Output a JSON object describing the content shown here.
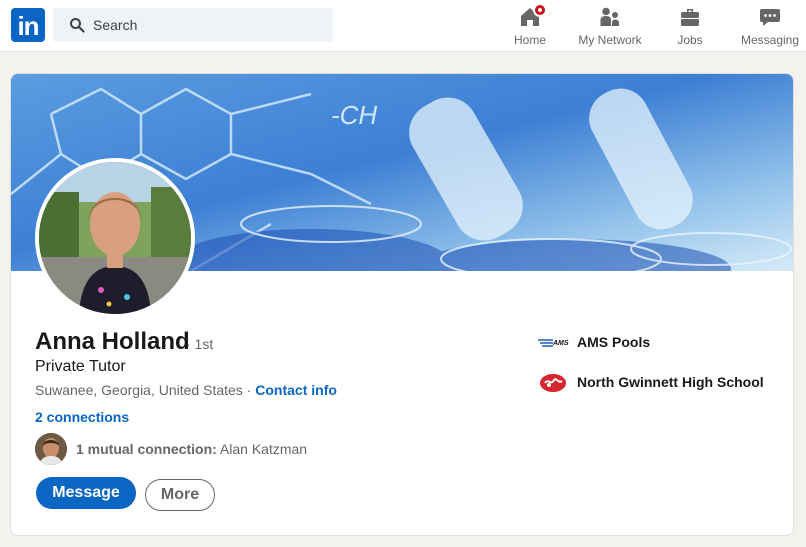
{
  "nav": {
    "logo_text": "in",
    "search_placeholder": "Search",
    "items": [
      {
        "label": "Home",
        "icon": "home-icon"
      },
      {
        "label": "My Network",
        "icon": "network-icon"
      },
      {
        "label": "Jobs",
        "icon": "briefcase-icon"
      },
      {
        "label": "Messaging",
        "icon": "chat-icon"
      }
    ]
  },
  "profile": {
    "name": "Anna Holland",
    "degree": "· 1st",
    "headline": "Private Tutor",
    "location": "Suwanee, Georgia, United States",
    "location_separator": " · ",
    "contact_label": "Contact info",
    "connections": "2 connections",
    "mutual_label": "1 mutual connection:",
    "mutual_name": "Alan Katzman",
    "message_button": "Message",
    "more_button": "More"
  },
  "experience": [
    {
      "name": "AMS Pools",
      "logo_text": "AMS"
    },
    {
      "name": "North Gwinnett High School"
    }
  ],
  "colors": {
    "brand": "#0a66c2",
    "notification": "#cc1016",
    "banner": "#3d7fd4"
  }
}
